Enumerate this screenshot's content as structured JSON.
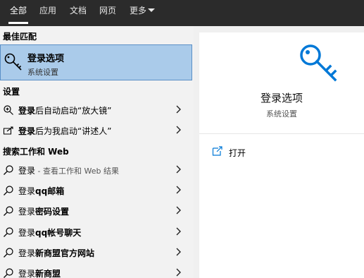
{
  "tabs": [
    {
      "label": "全部"
    },
    {
      "label": "应用"
    },
    {
      "label": "文档"
    },
    {
      "label": "网页"
    },
    {
      "label": "更多"
    }
  ],
  "best_match": {
    "section": "最佳匹配",
    "title": "登录选项",
    "subtitle": "系统设置",
    "icon": "key-icon"
  },
  "settings": {
    "section": "设置",
    "items": [
      {
        "bold": "登录",
        "rest": "后自动启动“放大镜”",
        "icon": "magnifier-icon"
      },
      {
        "bold": "登录",
        "rest": "后为我启动“讲述人”",
        "icon": "narrator-icon"
      }
    ]
  },
  "web": {
    "section": "搜索工作和 Web",
    "items": [
      {
        "pre": "登录",
        "bold": "",
        "muted": " - 查看工作和 Web 结果"
      },
      {
        "pre": "登录",
        "bold": "qq邮箱",
        "muted": ""
      },
      {
        "pre": "登录",
        "bold": "密码设置",
        "muted": ""
      },
      {
        "pre": "登录",
        "bold": "qq帐号聊天",
        "muted": ""
      },
      {
        "pre": "登录",
        "bold": "新商盟官方网站",
        "muted": ""
      },
      {
        "pre": "登录",
        "bold": "新商盟",
        "muted": ""
      }
    ]
  },
  "preview": {
    "title": "登录选项",
    "category": "系统设置",
    "action": "打开"
  },
  "colors": {
    "topbar": "#2b2b2b",
    "selected": "#aacbea",
    "accent": "#0078d7"
  }
}
